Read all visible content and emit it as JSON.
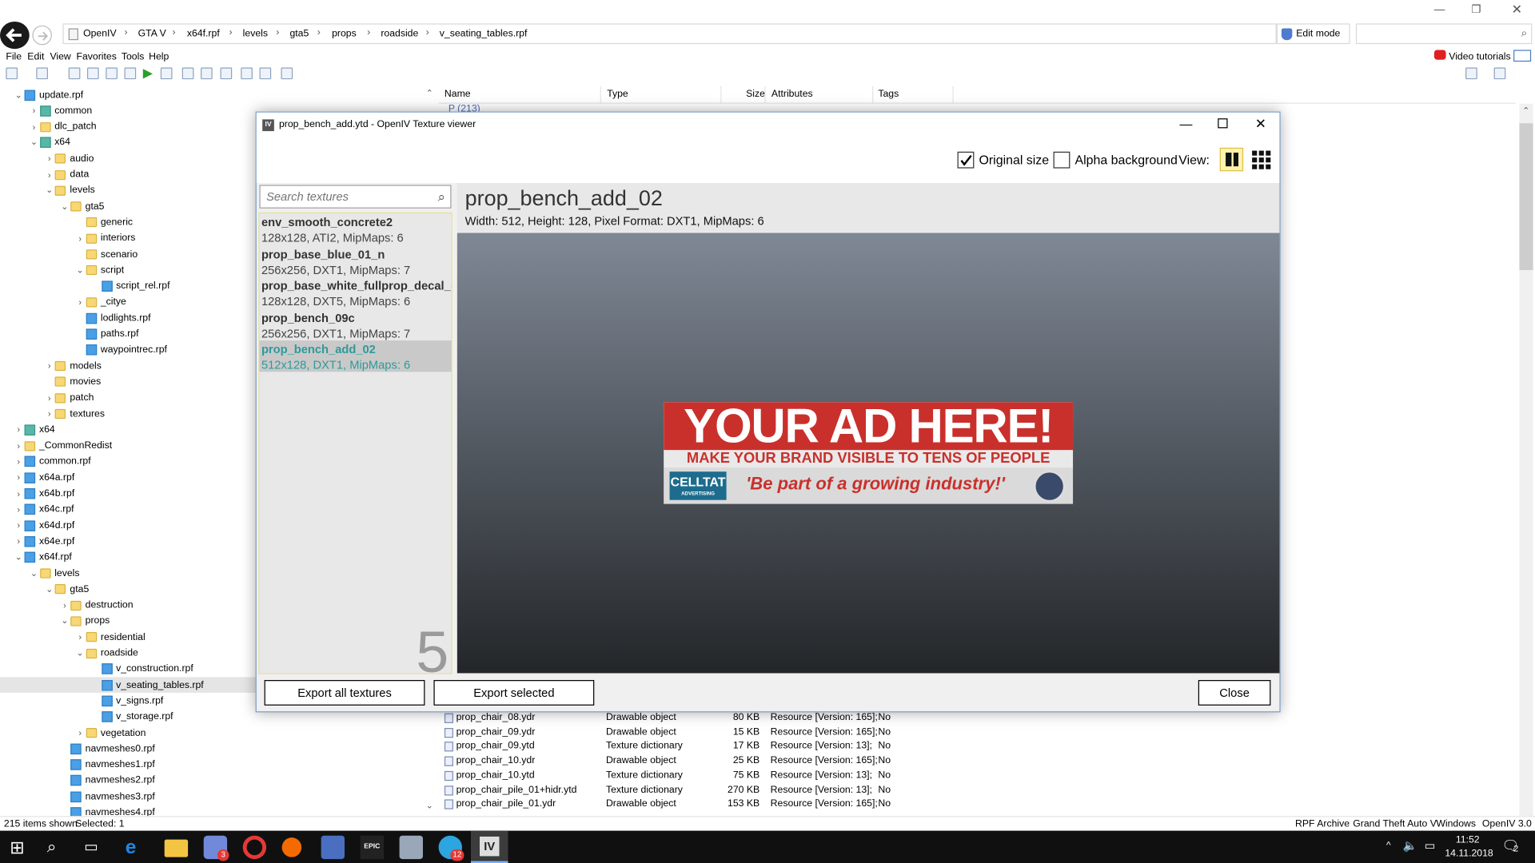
{
  "address": {
    "crumbs": [
      "OpenIV",
      "GTA V",
      "x64f.rpf",
      "levels",
      "gta5",
      "props",
      "roadside",
      "v_seating_tables.rpf"
    ],
    "edit_mode": "Edit mode"
  },
  "menu": [
    "File",
    "Edit",
    "View",
    "Favorites",
    "Tools",
    "Help"
  ],
  "video_tutorials": "Video tutorials",
  "tree": [
    {
      "label": "update.rpf",
      "indent": 0,
      "icon": "rpf",
      "arrow": "v"
    },
    {
      "label": "common",
      "indent": 1,
      "icon": "rpfg",
      "arrow": ">"
    },
    {
      "label": "dlc_patch",
      "indent": 1,
      "icon": "fold",
      "arrow": ">"
    },
    {
      "label": "x64",
      "indent": 1,
      "icon": "rpfg",
      "arrow": "v"
    },
    {
      "label": "audio",
      "indent": 2,
      "icon": "fold",
      "arrow": ">"
    },
    {
      "label": "data",
      "indent": 2,
      "icon": "fold",
      "arrow": ">"
    },
    {
      "label": "levels",
      "indent": 2,
      "icon": "fold",
      "arrow": "v"
    },
    {
      "label": "gta5",
      "indent": 3,
      "icon": "fold",
      "arrow": "v"
    },
    {
      "label": "generic",
      "indent": 4,
      "icon": "fold",
      "arrow": ""
    },
    {
      "label": "interiors",
      "indent": 4,
      "icon": "fold",
      "arrow": ">"
    },
    {
      "label": "scenario",
      "indent": 4,
      "icon": "fold",
      "arrow": ""
    },
    {
      "label": "script",
      "indent": 4,
      "icon": "fold",
      "arrow": "v"
    },
    {
      "label": "script_rel.rpf",
      "indent": 5,
      "icon": "rpf",
      "arrow": ""
    },
    {
      "label": "_citye",
      "indent": 4,
      "icon": "fold",
      "arrow": ">"
    },
    {
      "label": "lodlights.rpf",
      "indent": 4,
      "icon": "rpf",
      "arrow": ""
    },
    {
      "label": "paths.rpf",
      "indent": 4,
      "icon": "rpf",
      "arrow": ""
    },
    {
      "label": "waypointrec.rpf",
      "indent": 4,
      "icon": "rpf",
      "arrow": ""
    },
    {
      "label": "models",
      "indent": 2,
      "icon": "fold",
      "arrow": ">"
    },
    {
      "label": "movies",
      "indent": 2,
      "icon": "fold",
      "arrow": ""
    },
    {
      "label": "patch",
      "indent": 2,
      "icon": "fold",
      "arrow": ">"
    },
    {
      "label": "textures",
      "indent": 2,
      "icon": "fold",
      "arrow": ">"
    },
    {
      "label": "x64",
      "indent": 0,
      "icon": "rpfg",
      "arrow": ">"
    },
    {
      "label": "_CommonRedist",
      "indent": 0,
      "icon": "fold",
      "arrow": ">"
    },
    {
      "label": "common.rpf",
      "indent": 0,
      "icon": "rpf",
      "arrow": ">"
    },
    {
      "label": "x64a.rpf",
      "indent": 0,
      "icon": "rpf",
      "arrow": ">"
    },
    {
      "label": "x64b.rpf",
      "indent": 0,
      "icon": "rpf",
      "arrow": ">"
    },
    {
      "label": "x64c.rpf",
      "indent": 0,
      "icon": "rpf",
      "arrow": ">"
    },
    {
      "label": "x64d.rpf",
      "indent": 0,
      "icon": "rpf",
      "arrow": ">"
    },
    {
      "label": "x64e.rpf",
      "indent": 0,
      "icon": "rpf",
      "arrow": ">"
    },
    {
      "label": "x64f.rpf",
      "indent": 0,
      "icon": "rpf",
      "arrow": "v"
    },
    {
      "label": "levels",
      "indent": 1,
      "icon": "fold",
      "arrow": "v"
    },
    {
      "label": "gta5",
      "indent": 2,
      "icon": "fold",
      "arrow": "v"
    },
    {
      "label": "destruction",
      "indent": 3,
      "icon": "fold",
      "arrow": ">"
    },
    {
      "label": "props",
      "indent": 3,
      "icon": "fold",
      "arrow": "v"
    },
    {
      "label": "residential",
      "indent": 4,
      "icon": "fold",
      "arrow": ">"
    },
    {
      "label": "roadside",
      "indent": 4,
      "icon": "fold",
      "arrow": "v"
    },
    {
      "label": "v_construction.rpf",
      "indent": 5,
      "icon": "rpf",
      "arrow": ""
    },
    {
      "label": "v_seating_tables.rpf",
      "indent": 5,
      "icon": "rpf",
      "arrow": "",
      "selected": true
    },
    {
      "label": "v_signs.rpf",
      "indent": 5,
      "icon": "rpf",
      "arrow": ""
    },
    {
      "label": "v_storage.rpf",
      "indent": 5,
      "icon": "rpf",
      "arrow": ""
    },
    {
      "label": "vegetation",
      "indent": 4,
      "icon": "fold",
      "arrow": ">"
    },
    {
      "label": "navmeshes0.rpf",
      "indent": 3,
      "icon": "rpf",
      "arrow": ""
    },
    {
      "label": "navmeshes1.rpf",
      "indent": 3,
      "icon": "rpf",
      "arrow": ""
    },
    {
      "label": "navmeshes2.rpf",
      "indent": 3,
      "icon": "rpf",
      "arrow": ""
    },
    {
      "label": "navmeshes3.rpf",
      "indent": 3,
      "icon": "rpf",
      "arrow": ""
    },
    {
      "label": "navmeshes4.rpf",
      "indent": 3,
      "icon": "rpf",
      "arrow": ""
    }
  ],
  "list": {
    "headers": [
      "Name",
      "Type",
      "Size",
      "Attributes",
      "Tags"
    ],
    "group_label": "P (213)",
    "rows": [
      {
        "name": "prop_chair_08.ydr",
        "type": "Drawable object",
        "size": "80 KB",
        "attr": "Resource [Version: 165];",
        "tags": "No"
      },
      {
        "name": "prop_chair_09.ydr",
        "type": "Drawable object",
        "size": "15 KB",
        "attr": "Resource [Version: 165];",
        "tags": "No"
      },
      {
        "name": "prop_chair_09.ytd",
        "type": "Texture dictionary",
        "size": "17 KB",
        "attr": "Resource [Version: 13];",
        "tags": "No"
      },
      {
        "name": "prop_chair_10.ydr",
        "type": "Drawable object",
        "size": "25 KB",
        "attr": "Resource [Version: 165];",
        "tags": "No"
      },
      {
        "name": "prop_chair_10.ytd",
        "type": "Texture dictionary",
        "size": "75 KB",
        "attr": "Resource [Version: 13];",
        "tags": "No"
      },
      {
        "name": "prop_chair_pile_01+hidr.ytd",
        "type": "Texture dictionary",
        "size": "270 KB",
        "attr": "Resource [Version: 13];",
        "tags": "No"
      },
      {
        "name": "prop_chair_pile_01.ydr",
        "type": "Drawable object",
        "size": "153 KB",
        "attr": "Resource [Version: 165];",
        "tags": "No"
      }
    ]
  },
  "status": {
    "items_shown": "215 items shown",
    "selected": "Selected: 1",
    "archive": "RPF Archive",
    "game": "Grand Theft Auto V",
    "platform": "Windows",
    "version": "OpenIV 3.0"
  },
  "taskbar": {
    "time": "11:52",
    "date": "14.11.2018",
    "notif_count": "2",
    "badge1": "3",
    "badge2": "12"
  },
  "dialog": {
    "title": "prop_bench_add.ytd - OpenIV Texture viewer",
    "original_size": "Original size",
    "original_size_checked": true,
    "alpha_background": "Alpha background",
    "alpha_background_checked": false,
    "view_label": "View:",
    "search_placeholder": "Search textures",
    "textures": [
      {
        "name": "env_smooth_concrete2",
        "desc": "128x128, ATI2, MipMaps: 6"
      },
      {
        "name": "prop_base_blue_01_n",
        "desc": "256x256, DXT1, MipMaps: 7"
      },
      {
        "name": "prop_base_white_fullprop_decal_gra",
        "desc": "128x128, DXT5, MipMaps: 6"
      },
      {
        "name": "prop_bench_09c",
        "desc": "256x256, DXT1, MipMaps: 7"
      },
      {
        "name": "prop_bench_add_02",
        "desc": "512x128, DXT1, MipMaps: 6",
        "active": true
      }
    ],
    "texture_count": "5",
    "selected_name": "prop_bench_add_02",
    "selected_info": "Width: 512, Height: 128, Pixel Format: DXT1, MipMaps: 6",
    "ad": {
      "headline": "YOUR AD HERE!",
      "subline": "MAKE YOUR BRAND VISIBLE TO TENS OF PEOPLE DAILY",
      "logo": "CELLTAT",
      "logo_sub": "ADVERTISING",
      "slogan": "'Be part of a growing industry!'"
    },
    "export_all": "Export all textures",
    "export_selected": "Export selected",
    "close": "Close"
  }
}
